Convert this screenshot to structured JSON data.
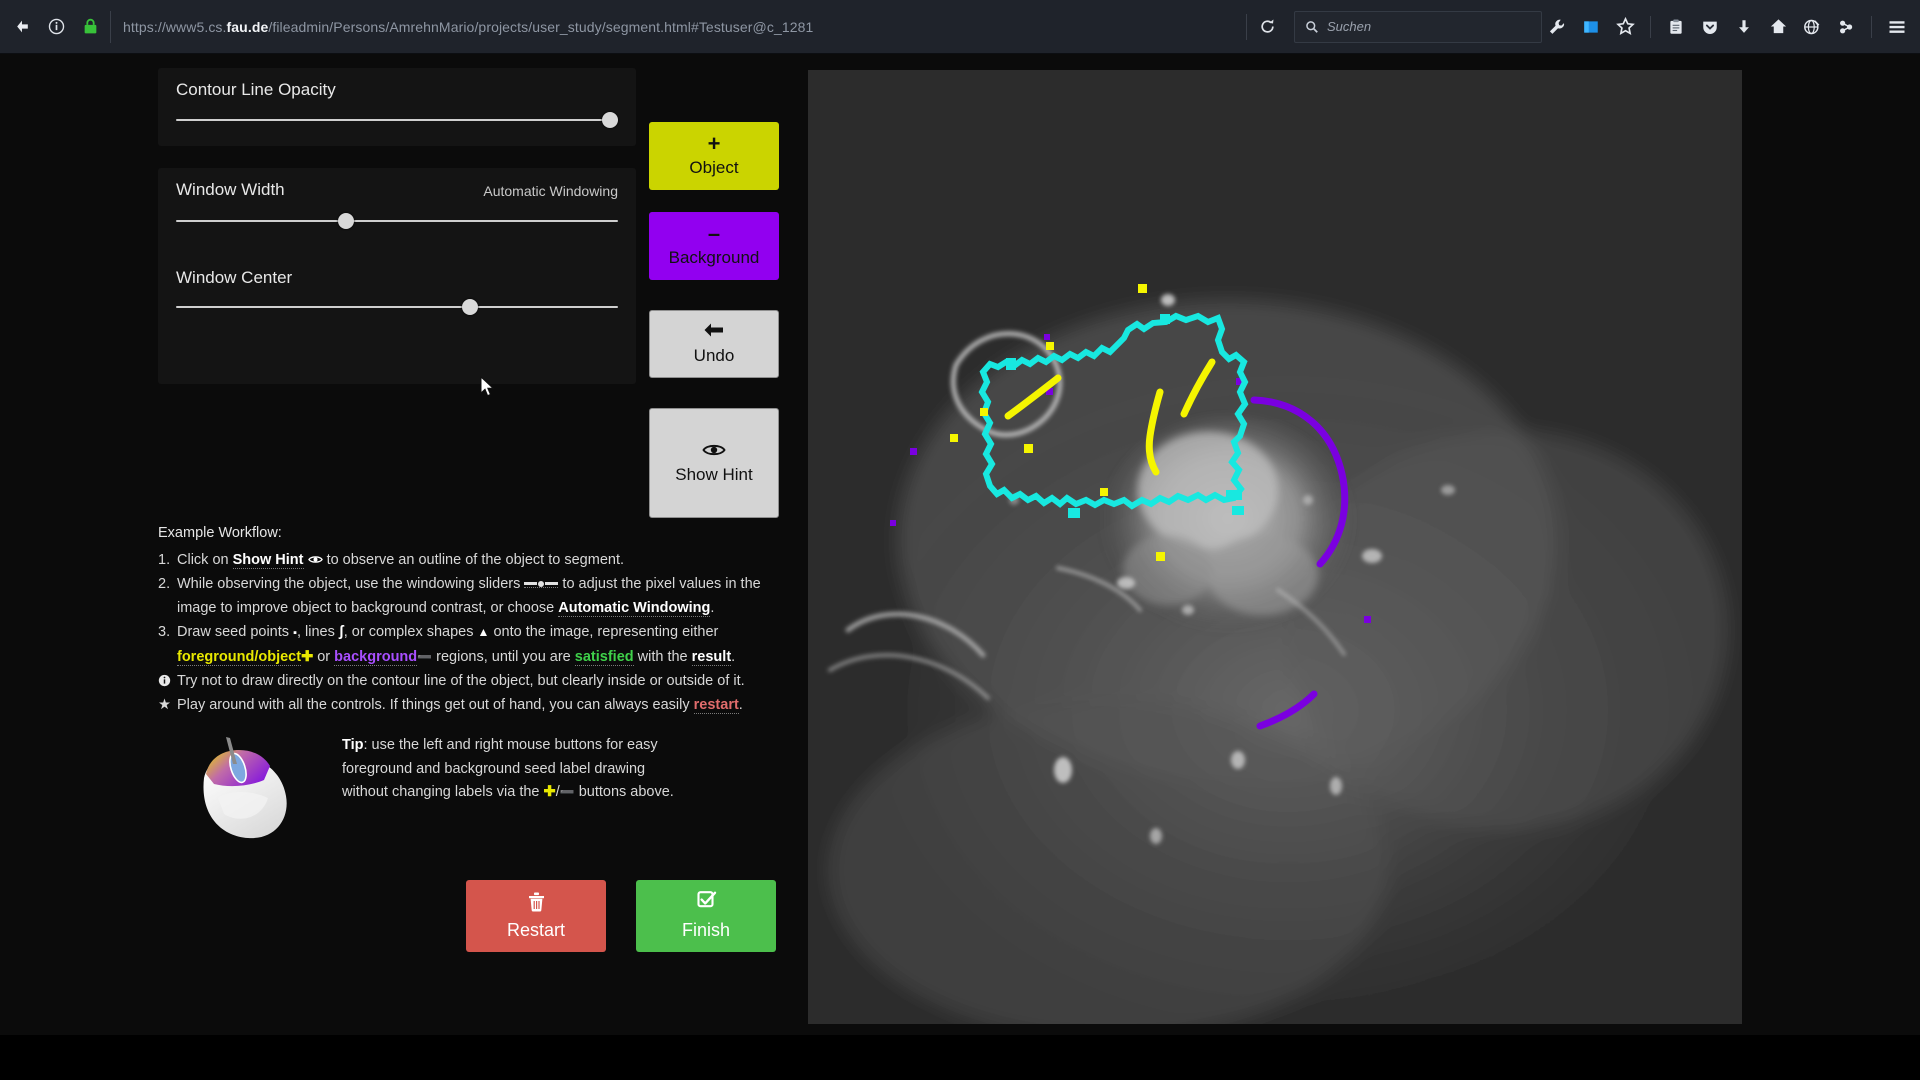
{
  "browser": {
    "url_prefix": "https://www5.cs.",
    "url_bold": "fau.de",
    "url_rest": "/fileadmin/Persons/AmrehnMario/projects/user_study/segment.html#Testuser@c_1281",
    "search_placeholder": "Suchen",
    "icons": {
      "back": "back-arrow-icon",
      "info": "info-icon",
      "lock": "lock-icon",
      "reload": "reload-icon",
      "search": "search-icon",
      "wrench": "wrench-icon",
      "bookmarks_sidebar": "sidebar-icon",
      "star": "star-icon",
      "clipboard": "clipboard-icon",
      "pocket": "pocket-icon",
      "download": "download-icon",
      "home": "home-icon",
      "globe": "globe-icon",
      "account": "account-icon",
      "menu": "hamburger-menu-icon"
    }
  },
  "sliders": {
    "opacity": {
      "label": "Contour Line Opacity",
      "value": 100
    },
    "window_width": {
      "label": "Window Width",
      "right_label": "Automatic Windowing",
      "value": 42
    },
    "window_center": {
      "label": "Window Center",
      "value": 70
    }
  },
  "tool_buttons": [
    {
      "name": "object",
      "icon": "+",
      "label": "Object",
      "color": "#cbd400"
    },
    {
      "name": "background",
      "icon": "–",
      "label": "Background",
      "color": "#9200f0"
    },
    {
      "name": "undo",
      "icon": "←",
      "label": "Undo",
      "color": "#d4d4d4"
    },
    {
      "name": "show-hint",
      "icon": "\u0001",
      "label": "Show Hint",
      "color": "#d4d4d4"
    }
  ],
  "workflow": {
    "title": "Example Workflow:",
    "n1": "1.",
    "n2": "2.",
    "n3": "3.",
    "step1_a": "Click on ",
    "step1_b": "Show Hint",
    "step1_c": " to observe an outline of the object to segment.",
    "step2_a": "While observing the object, use the windowing sliders ",
    "step2_b": " to adjust the pixel values in the",
    "step2_c": "image to improve object to background contrast, or choose ",
    "step2_d": "Automatic Windowing",
    "step2_e": ".",
    "step3_a": "Draw seed points ",
    "step3_dot": "▪",
    "step3_b": ", lines ",
    "step3_line": "ʃ",
    "step3_c": ", or complex shapes ",
    "step3_tri": "▲",
    "step3_d": " onto the image, representing either",
    "step3_e": "foreground/object",
    "step3_plus": "✚",
    "step3_f": " or ",
    "step3_g": "background",
    "step3_minus": "➖",
    "step3_h": " regions, until you are ",
    "step3_i": "satisfied",
    "step3_j": " with the ",
    "step3_k": "result",
    "step3_l": ".",
    "note_a": "Try not to draw directly on the contour line of the object, but clearly inside or outside of it.",
    "note_star": "★",
    "note_b": "Play around with all the controls. If things get out of hand, you can always easily ",
    "note_c": "restart",
    "note_d": "."
  },
  "tip": {
    "label": "Tip",
    "a": ": use the left and right mouse buttons for easy",
    "b": "foreground and background seed label drawing",
    "c": "without changing labels via the ",
    "plus": "✚",
    "slash": "/",
    "minus": "➖",
    "d": " buttons above."
  },
  "bottom_buttons": [
    {
      "name": "restart",
      "icon": "🗑",
      "label": "Restart",
      "color": "#d4554c"
    },
    {
      "name": "finish",
      "icon": "☑",
      "label": "Finish",
      "color": "#4cbf4c"
    }
  ],
  "canvas": {
    "name": "medical-image-segmentation-canvas",
    "contour_color": "#18e8e0",
    "foreground_seed_color": "#f5f500",
    "background_seed_color": "#7a00e0",
    "description": "Grayscale CT slice with cyan segmentation contour, yellow foreground seeds and purple background seeds"
  }
}
